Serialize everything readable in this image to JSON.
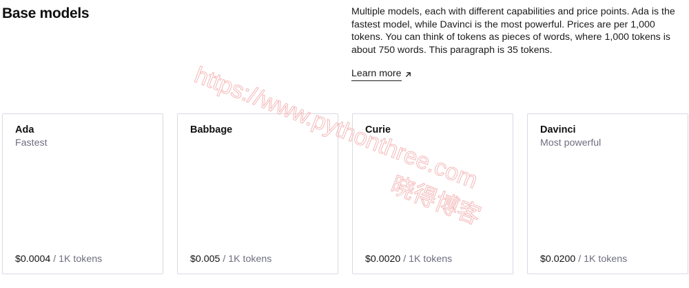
{
  "header": {
    "title": "Base models",
    "description": "Multiple models, each with different capabilities and price points. Ada is the fastest model, while Davinci is the most powerful. Prices are per 1,000 tokens. You can think of tokens as pieces of words, where 1,000 tokens is about 750 words. This paragraph is 35 tokens.",
    "learn_more_label": "Learn more",
    "learn_more_icon": "arrow-up-right-icon"
  },
  "models": [
    {
      "name": "Ada",
      "description": "Fastest",
      "price": "$0.0004",
      "unit": " / 1K tokens"
    },
    {
      "name": "Babbage",
      "description": "",
      "price": "$0.005",
      "unit": " / 1K tokens"
    },
    {
      "name": "Curie",
      "description": "",
      "price": "$0.0020",
      "unit": " / 1K tokens"
    },
    {
      "name": "Davinci",
      "description": "Most powerful",
      "price": "$0.0200",
      "unit": " / 1K tokens"
    }
  ],
  "watermark": {
    "url_text": "https://www.pythonthree.com",
    "brand_text": "晓得博客",
    "color": "#f4b8b8"
  },
  "colors": {
    "text": "#111111",
    "muted": "#6e6e80",
    "card_border": "#d9d9e3"
  }
}
